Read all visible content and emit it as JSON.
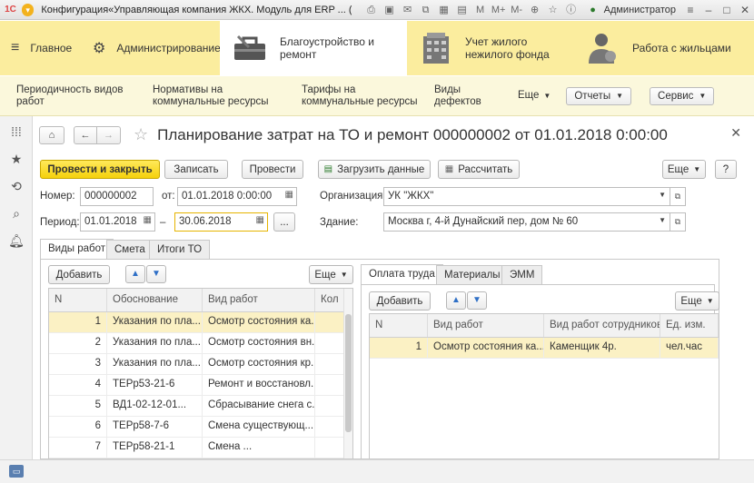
{
  "window": {
    "logo": "1С",
    "title": "Конфигурация«Управляющая компания ЖКХ. Модуль для ERP ...  (1С:Предприятие)",
    "user": "Администратор",
    "icons": [
      "print-icon",
      "save-icon",
      "mail-icon",
      "copy-icon",
      "calendar-icon",
      "calc-icon",
      "m-icon",
      "m-plus-icon",
      "m-minus-icon",
      "zoom-icon",
      "star-icon",
      "info-icon"
    ]
  },
  "sections": [
    {
      "label": "Главное",
      "icon": "menu-icon"
    },
    {
      "label": "Администрирование",
      "icon": "gear-icon"
    },
    {
      "label": "Благоустройство и ремонт",
      "icon": "toolbox-icon",
      "active": true
    },
    {
      "label": "Учет жилого нежилого фонда",
      "icon": "building-icon"
    },
    {
      "label": "Работа с жильцами",
      "icon": "people-icon"
    }
  ],
  "funcbar": {
    "items": [
      "Периодичность видов работ",
      "Нормативы на коммунальные ресурсы",
      "Тарифы на коммунальные ресурсы",
      "Виды дефектов"
    ],
    "more": "Еще",
    "reports": "Отчеты",
    "service": "Сервис"
  },
  "form": {
    "title": "Планирование затрат на ТО и ремонт 000000002 от 01.01.2018 0:00:00",
    "buttons": {
      "post_close": "Провести и закрыть",
      "save": "Записать",
      "post": "Провести",
      "load": "Загрузить данные",
      "calc": "Рассчитать",
      "more": "Еще",
      "help": "?"
    },
    "number_label": "Номер:",
    "number": "000000002",
    "from_label": "от:",
    "date": "01.01.2018  0:00:00",
    "org_label": "Организация:",
    "org": "УК \"ЖКХ\"",
    "period_label": "Период:",
    "period_from": "01.01.2018",
    "period_dash": "–",
    "period_to": "30.06.2018",
    "period_btn": "...",
    "building_label": "Здание:",
    "building": "Москва г, 4-й Дунайский пер, дом № 60"
  },
  "tabs": [
    "Виды работ",
    "Смета",
    "Итоги ТО"
  ],
  "left_table": {
    "add": "Добавить",
    "more": "Еще",
    "headers": [
      "N",
      "Обоснование",
      "Вид работ",
      "Кол"
    ],
    "rows": [
      [
        "1",
        "Указания по пла...",
        "Осмотр состояния ка..."
      ],
      [
        "2",
        "Указания по пла...",
        "Осмотр состояния вн..."
      ],
      [
        "3",
        "Указания по пла...",
        "Осмотр состояния кр..."
      ],
      [
        "4",
        "ТЕРр53-21-6",
        "Ремонт и восстановл..."
      ],
      [
        "5",
        "ВД1-02-12-01...",
        "Сбрасывание снега с..."
      ],
      [
        "6",
        "ТЕРр58-7-6",
        "Смена существующ..."
      ],
      [
        "7",
        "ТЕРр58-21-1",
        "Смена ..."
      ]
    ]
  },
  "right_tabs": [
    "Оплата труда",
    "Материалы",
    "ЭММ"
  ],
  "right_table": {
    "add": "Добавить",
    "more": "Еще",
    "headers": [
      "N",
      "Вид работ",
      "Вид работ сотрудников",
      "Ед. изм."
    ],
    "rows": [
      [
        "1",
        "Осмотр состояния ка...",
        "Каменщик 4р.",
        "чел.час"
      ]
    ]
  }
}
